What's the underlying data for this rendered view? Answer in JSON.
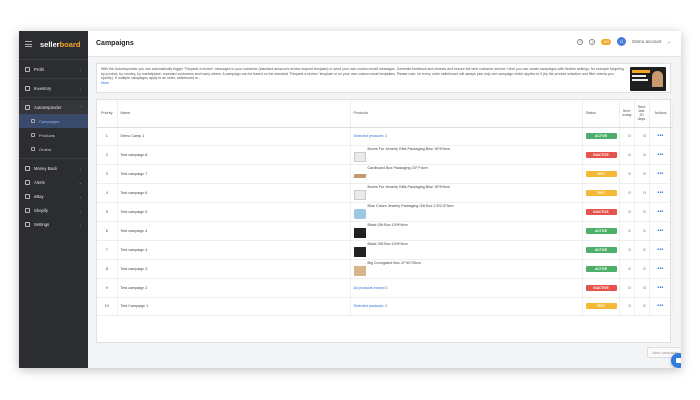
{
  "brand": {
    "name_prefix": "seller",
    "name_suffix": "board"
  },
  "sidebar": {
    "items": [
      {
        "label": "Profit",
        "icon": "profit-icon"
      },
      {
        "label": "Inventory",
        "icon": "inventory-icon"
      },
      {
        "label": "Autoresponder",
        "icon": "autoresponder-icon"
      },
      {
        "label": "Campaigns",
        "icon": "campaigns-icon"
      },
      {
        "label": "Products",
        "icon": "products-icon"
      },
      {
        "label": "Orders",
        "icon": "orders-icon"
      },
      {
        "label": "Money Back",
        "icon": "money-back-icon"
      },
      {
        "label": "Alerts",
        "icon": "alerts-icon"
      },
      {
        "label": "eBay",
        "icon": "ebay-icon"
      },
      {
        "label": "Shopify",
        "icon": "shopify-icon"
      },
      {
        "label": "Settings",
        "icon": "settings-icon"
      }
    ]
  },
  "header": {
    "title": "Campaigns",
    "badge": "200",
    "account_label": "Demo account",
    "avatar_initial": "D"
  },
  "info": {
    "text": "With the Autoresponder you can automatically trigger \"Request a review\" messages to your customer (standard amazon's review request template) or send your own custom email messages. Generate feedback and reviews and ensure the best customer service. Here you can create campaigns with flexible settings, for example targeting by product, by country, by marketplace, repeated customers and many others. A campaign can be based on the standard \"Request a review\" template or on your own custom email templates. Please note, for every order sellerboard will always pick only one campaign which applies to it (by the product selection and filter criteria you specify). If multiple campaigns apply to an order, sellerboard w...",
    "more": "More"
  },
  "table": {
    "headers": {
      "priority": "Priority",
      "name": "Name",
      "products": "Products",
      "status": "Status",
      "sent_today": "Sent today",
      "sent_last": "Sent last 30 days",
      "actions": "Actions"
    },
    "rows": [
      {
        "priority": "1",
        "name": "Demo Camp 1",
        "products": "Selected products: 2",
        "product_type": "link",
        "status": "ACTIVE",
        "status_type": "active",
        "sent_today": "0",
        "sent_last": "0"
      },
      {
        "priority": "2",
        "name": "Test campaign 8",
        "products": "Boxes For Jewelry Gifts Packaging Blue 10*5*4cm",
        "product_type": "white",
        "status": "INACTIVE",
        "status_type": "inactive",
        "sent_today": "0",
        "sent_last": "0"
      },
      {
        "priority": "3",
        "name": "Test campaign 7",
        "products": "Cardboard Box Packaging 23*7*4cm",
        "product_type": "cardboard",
        "status": "TEST",
        "status_type": "test",
        "sent_today": "0",
        "sent_last": "0"
      },
      {
        "priority": "4",
        "name": "Test campaign 6",
        "products": "Boxes For Jewelry Gifts Packaging Blue 10*5*4cm",
        "product_type": "white",
        "status": "TEST",
        "status_type": "test",
        "sent_today": "0",
        "sent_last": "0"
      },
      {
        "priority": "5",
        "name": "Test campaign 5",
        "products": "Blue Colors Jewelry Packaging Gift Box 2.5*2.5*3cm",
        "product_type": "blue",
        "status": "INACTIVE",
        "status_type": "inactive",
        "sent_today": "0",
        "sent_last": "0"
      },
      {
        "priority": "6",
        "name": "Test campaign 4",
        "products": "Black Gift Box 10*8*6cm",
        "product_type": "dark",
        "status": "ACTIVE",
        "status_type": "active",
        "sent_today": "0",
        "sent_last": "0"
      },
      {
        "priority": "7",
        "name": "Test campaign 4",
        "products": "Black Gift Box 10*8*6cm",
        "product_type": "dark",
        "status": "ACTIVE",
        "status_type": "active",
        "sent_today": "0",
        "sent_last": "0"
      },
      {
        "priority": "8",
        "name": "Test campaign 3",
        "products": "Big Corrugated Box 47*40*25cm",
        "product_type": "box",
        "status": "ACTIVE",
        "status_type": "active",
        "sent_today": "0",
        "sent_last": "0"
      },
      {
        "priority": "9",
        "name": "Test campaign 2",
        "products": "All products except 1",
        "product_type": "link",
        "status": "INACTIVE",
        "status_type": "inactive",
        "sent_today": "0",
        "sent_last": "0"
      },
      {
        "priority": "10",
        "name": "Test Campaign 1",
        "products": "Selected products: 2",
        "product_type": "link",
        "status": "TEST",
        "status_type": "test",
        "sent_today": "0",
        "sent_last": "0"
      }
    ],
    "actions_glyph": "•••"
  },
  "new_campaign_label": "New campaign"
}
